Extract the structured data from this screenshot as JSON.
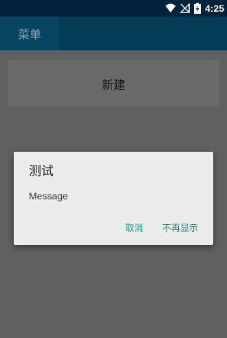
{
  "status_bar": {
    "time": "4:25",
    "icons": [
      "wifi-icon",
      "signal-off-icon",
      "battery-charging-icon"
    ]
  },
  "app_bar": {
    "menu_label": "菜单"
  },
  "main": {
    "new_button_label": "新建"
  },
  "dialog": {
    "title": "测试",
    "message": "Message",
    "cancel_label": "取消",
    "dont_show_label": "不再显示",
    "accent_color": "#1a8a80"
  },
  "colors": {
    "status_bar": "#02233a",
    "app_bar": "#043b57",
    "background_dimmed": "#606060"
  }
}
